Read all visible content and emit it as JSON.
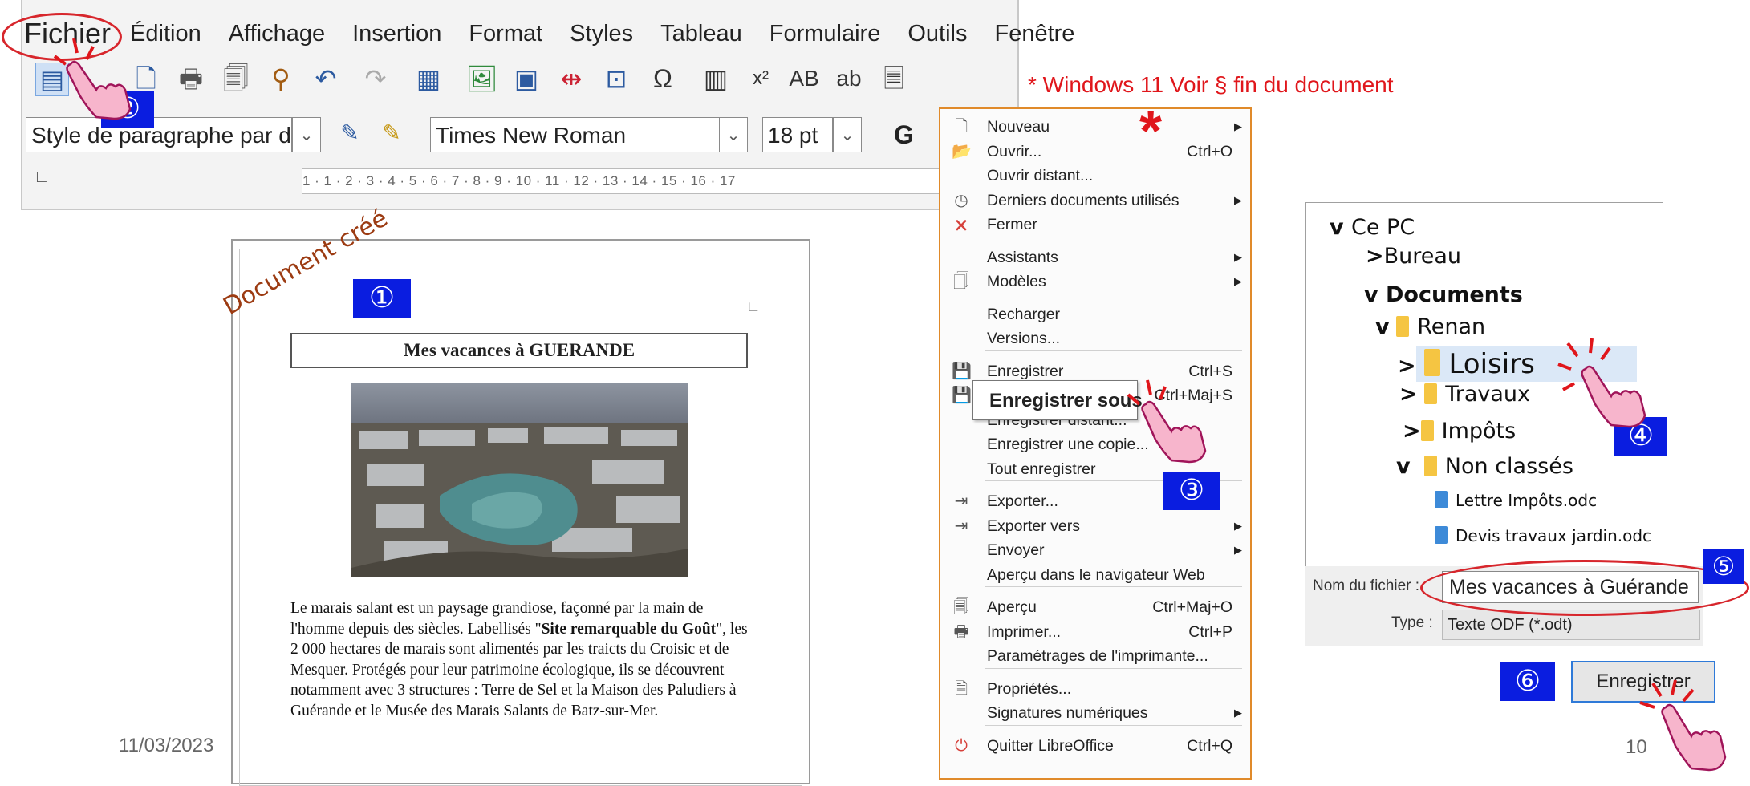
{
  "menubar": {
    "items": [
      "Fichier",
      "Édition",
      "Affichage",
      "Insertion",
      "Format",
      "Styles",
      "Tableau",
      "Formulaire",
      "Outils",
      "Fenêtre"
    ]
  },
  "toolbar": {
    "paragraph_style": "Style de paragraphe par déf",
    "font_name": "Times New Roman",
    "font_size": "18 pt",
    "bold": "G",
    "superscript": "x²",
    "ruler_ticks": "1 · 1 · 2 · 3 · 4 · 5 · 6 · 7 · 8 · 9 · 10 · 11 · 12 · 13 · 14 · 15 · 16 · 17"
  },
  "annotations": {
    "windows_note": "* Windows 11 Voir § fin du document",
    "star": "*",
    "doc_created": "Document créé",
    "badges": [
      "①",
      "②",
      "③",
      "④",
      "⑤",
      "⑥"
    ]
  },
  "document": {
    "title": "Mes vacances à  GUERANDE",
    "body_html": "Le marais salant est un paysage grandiose, façonné par la main de l'homme depuis des siècles. Labellisés \"<b>Site remarquable du Goût</b>\", les 2 000 hectares de marais sont alimentés par les traicts du Croisic et de Mesquer. Protégés pour leur patrimoine écologique, ils se découvrent notamment avec 3 structures : Terre de Sel et la Maison des Paludiers à Guérande et le Musée des Marais Salants de Batz-sur-Mer."
  },
  "footer": {
    "date": "11/03/2023",
    "page": "10"
  },
  "file_menu": {
    "items": [
      {
        "label": "Nouveau",
        "shortcut": "",
        "submenu": true,
        "icon": "new-doc-icon"
      },
      {
        "label": "Ouvrir...",
        "shortcut": "Ctrl+O",
        "submenu": false,
        "icon": "open-folder-icon"
      },
      {
        "label": "Ouvrir distant...",
        "shortcut": "",
        "submenu": false,
        "icon": ""
      },
      {
        "label": "Derniers documents utilisés",
        "shortcut": "",
        "submenu": true,
        "icon": "clock-icon"
      },
      {
        "label": "Fermer",
        "shortcut": "",
        "submenu": false,
        "icon": "close-doc-icon"
      },
      {
        "label": "Assistants",
        "shortcut": "",
        "submenu": true,
        "icon": ""
      },
      {
        "label": "Modèles",
        "shortcut": "",
        "submenu": true,
        "icon": "template-icon"
      },
      {
        "label": "Recharger",
        "shortcut": "",
        "submenu": false,
        "icon": ""
      },
      {
        "label": "Versions...",
        "shortcut": "",
        "submenu": false,
        "icon": ""
      },
      {
        "label": "Enregistrer",
        "shortcut": "Ctrl+S",
        "submenu": false,
        "icon": "save-icon"
      },
      {
        "label": "Enregistrer sous",
        "shortcut": "Ctrl+Maj+S",
        "submenu": false,
        "icon": "save-as-icon"
      },
      {
        "label": "Enregistrer distant...",
        "shortcut": "",
        "submenu": false,
        "icon": ""
      },
      {
        "label": "Enregistrer une copie...",
        "shortcut": "",
        "submenu": false,
        "icon": ""
      },
      {
        "label": "Tout enregistrer",
        "shortcut": "",
        "submenu": false,
        "icon": ""
      },
      {
        "label": "Exporter...",
        "shortcut": "",
        "submenu": false,
        "icon": "export-icon"
      },
      {
        "label": "Exporter vers",
        "shortcut": "",
        "submenu": true,
        "icon": "export-icon"
      },
      {
        "label": "Envoyer",
        "shortcut": "",
        "submenu": true,
        "icon": ""
      },
      {
        "label": "Aperçu dans le navigateur Web",
        "shortcut": "",
        "submenu": false,
        "icon": ""
      },
      {
        "label": "Aperçu",
        "shortcut": "Ctrl+Maj+O",
        "submenu": false,
        "icon": "preview-icon"
      },
      {
        "label": "Imprimer...",
        "shortcut": "Ctrl+P",
        "submenu": false,
        "icon": "print-icon"
      },
      {
        "label": "Paramétrages de l'imprimante...",
        "shortcut": "",
        "submenu": false,
        "icon": ""
      },
      {
        "label": "Propriétés...",
        "shortcut": "",
        "submenu": false,
        "icon": "properties-icon"
      },
      {
        "label": "Signatures numériques",
        "shortcut": "",
        "submenu": true,
        "icon": ""
      },
      {
        "label": "Quitter LibreOffice",
        "shortcut": "Ctrl+Q",
        "submenu": false,
        "icon": "power-icon"
      }
    ],
    "hover_popup": "Enregistrer sous"
  },
  "save_dialog": {
    "tree": {
      "ce_pc": "Ce PC",
      "bureau": "Bureau",
      "documents": "Documents",
      "renan": "Renan",
      "loisirs": "Loisirs",
      "travaux": "Travaux",
      "impots": "Impôts",
      "non_classes": "Non classés",
      "file1": "Lettre Impôts.odc",
      "file2": "Devis travaux jardin.odc"
    },
    "filename_label": "Nom du fichier :",
    "filename_value": "Mes vacances à Guérande",
    "type_label": "Type :",
    "type_value": "Texte ODF (*.odt)",
    "save_button": "Enregistrer"
  }
}
